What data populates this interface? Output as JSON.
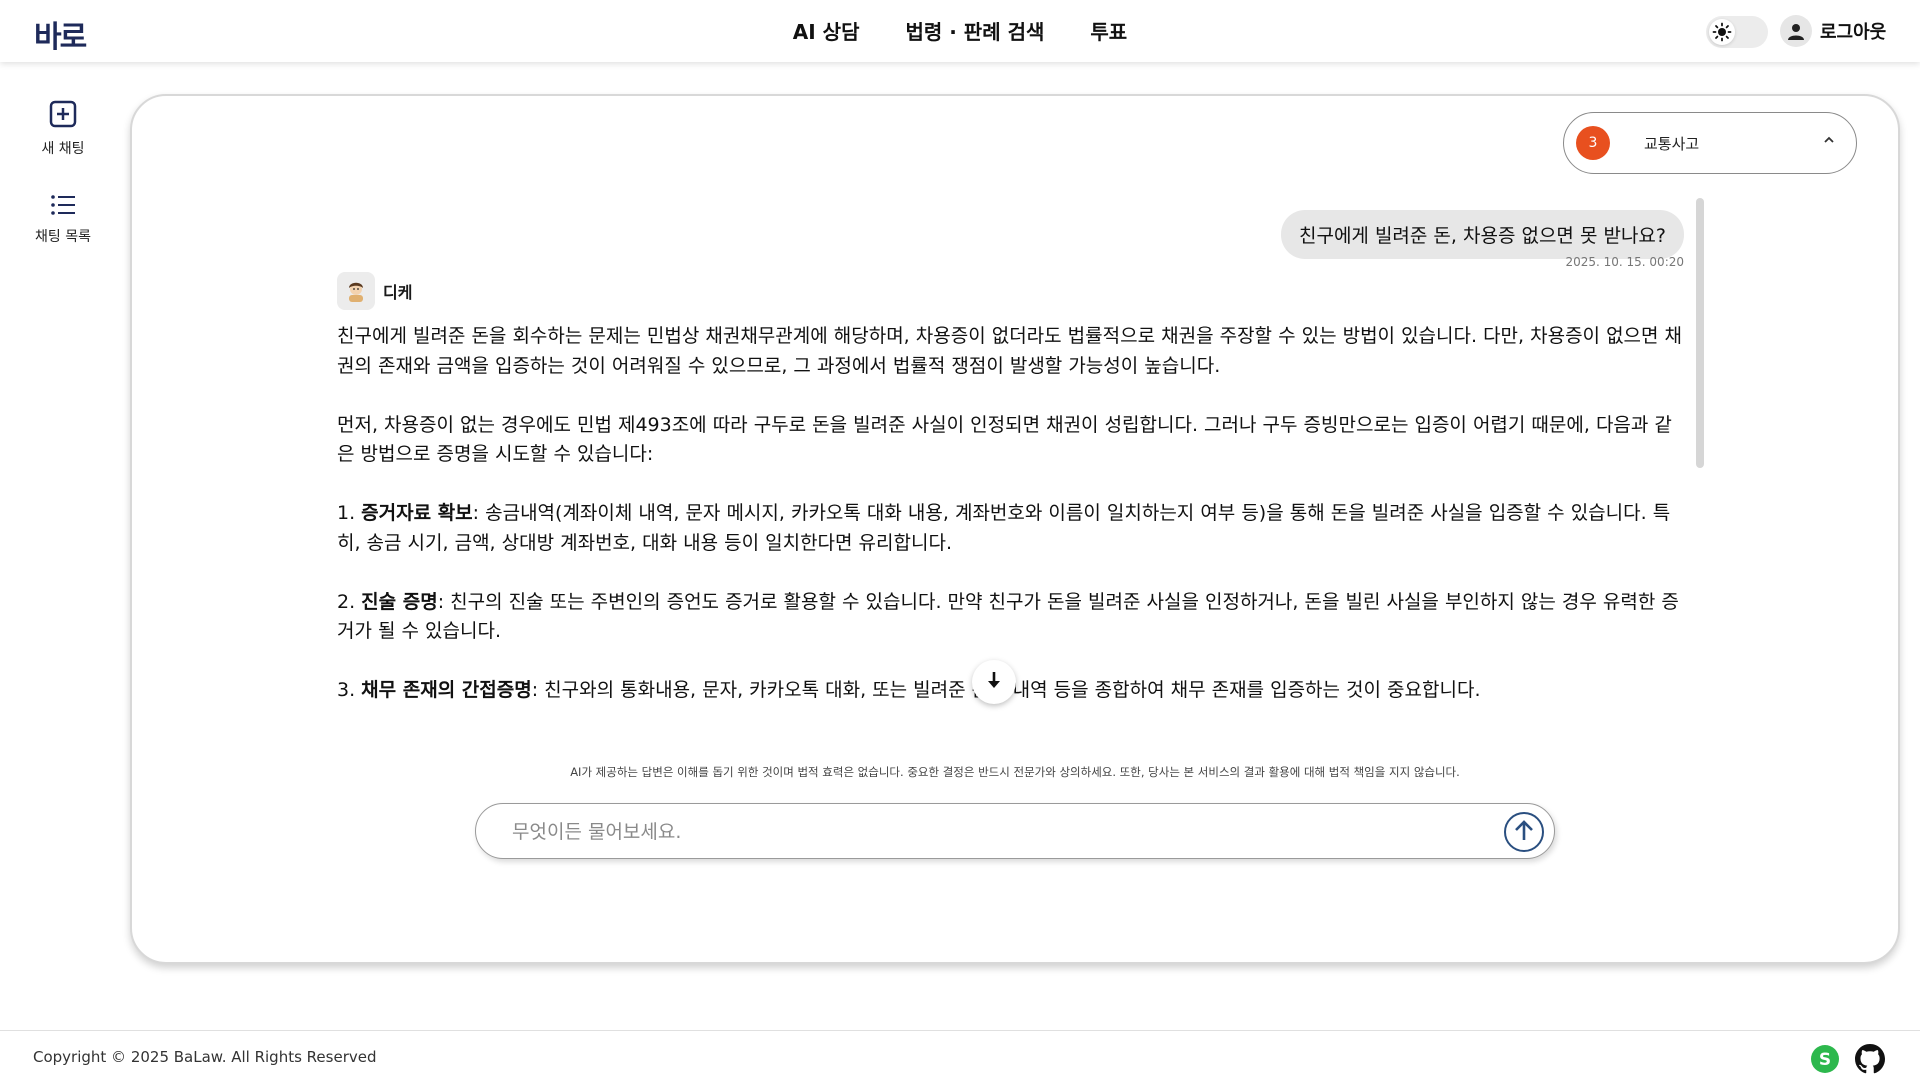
{
  "header": {
    "logo": "바로",
    "nav": [
      "AI 상담",
      "법령 · 판례 검색",
      "투표"
    ],
    "logout_label": "로그아웃"
  },
  "sidebar": {
    "new_chat": "새 채팅",
    "chat_list": "채팅 목록"
  },
  "category": {
    "count": "3",
    "label": "교통사고",
    "badge_color": "#e8501f"
  },
  "conversation": {
    "user_message": "친구에게 빌려준 돈, 차용증 없으면 못 받나요?",
    "user_time": "2025. 10. 15. 00:20",
    "bot_name": "디케",
    "paragraphs": [
      "친구에게 빌려준 돈을 회수하는 문제는 민법상 채권채무관계에 해당하며, 차용증이 없더라도 법률적으로 채권을 주장할 수 있는 방법이 있습니다. 다만, 차용증이 없으면 채권의 존재와 금액을 입증하는 것이 어려워질 수 있으므로, 그 과정에서 법률적 쟁점이 발생할 가능성이 높습니다.",
      "먼저, 차용증이 없는 경우에도 민법 제493조에 따라 구두로 돈을 빌려준 사실이 인정되면 채권이 성립합니다. 그러나 구두 증빙만으로는 입증이 어렵기 때문에, 다음과 같은 방법으로 증명을 시도할 수 있습니다:"
    ],
    "items": [
      {
        "num": "1. ",
        "title": "증거자료 확보",
        "text": ": 송금내역(계좌이체 내역, 문자 메시지, 카카오톡 대화 내용, 계좌번호와 이름이 일치하는지 여부 등)을 통해 돈을 빌려준 사실을 입증할 수 있습니다. 특히, 송금 시기, 금액, 상대방 계좌번호, 대화 내용 등이 일치한다면 유리합니다."
      },
      {
        "num": "2. ",
        "title": "진술 증명",
        "text": ": 친구의 진술 또는 주변인의 증언도 증거로 활용할 수 있습니다. 만약 친구가 돈을 빌려준 사실을 인정하거나, 돈을 빌린 사실을 부인하지 않는 경우 유력한 증거가 될 수 있습니다."
      },
      {
        "num": "3. ",
        "title": "채무 존재의 간접증명",
        "text": ": 친구와의 통화내용, 문자, 카카오톡 대화, 또는 빌려준 돈의 내역 등을 종합하여 채무 존재를 입증하는 것이 중요합니다."
      }
    ]
  },
  "disclaimer": "AI가 제공하는 답변은 이해를 돕기 위한 것이며 법적 효력은 없습니다. 중요한 결정은 반드시 전문가와 상의하세요. 또한, 당사는 본 서비스의 결과 활용에 대해 법적 책임을 지지 않습니다.",
  "input": {
    "placeholder": "무엇이든 물어보세요.",
    "value": ""
  },
  "footer": {
    "copyright": "Copyright © 2025 BaLaw. All Rights Reserved"
  },
  "icons": {
    "theme": "sun-icon",
    "user": "user-icon",
    "new_chat": "plus-square-icon",
    "chat_list": "list-icon",
    "scroll_down": "arrow-down-icon",
    "send": "arrow-up-icon",
    "footer_s": "s-logo-icon",
    "footer_github": "github-icon"
  },
  "colors": {
    "brand": "#1e2a5a",
    "send_border": "#2a4f80",
    "footer_s_icon": "#2db84d"
  }
}
